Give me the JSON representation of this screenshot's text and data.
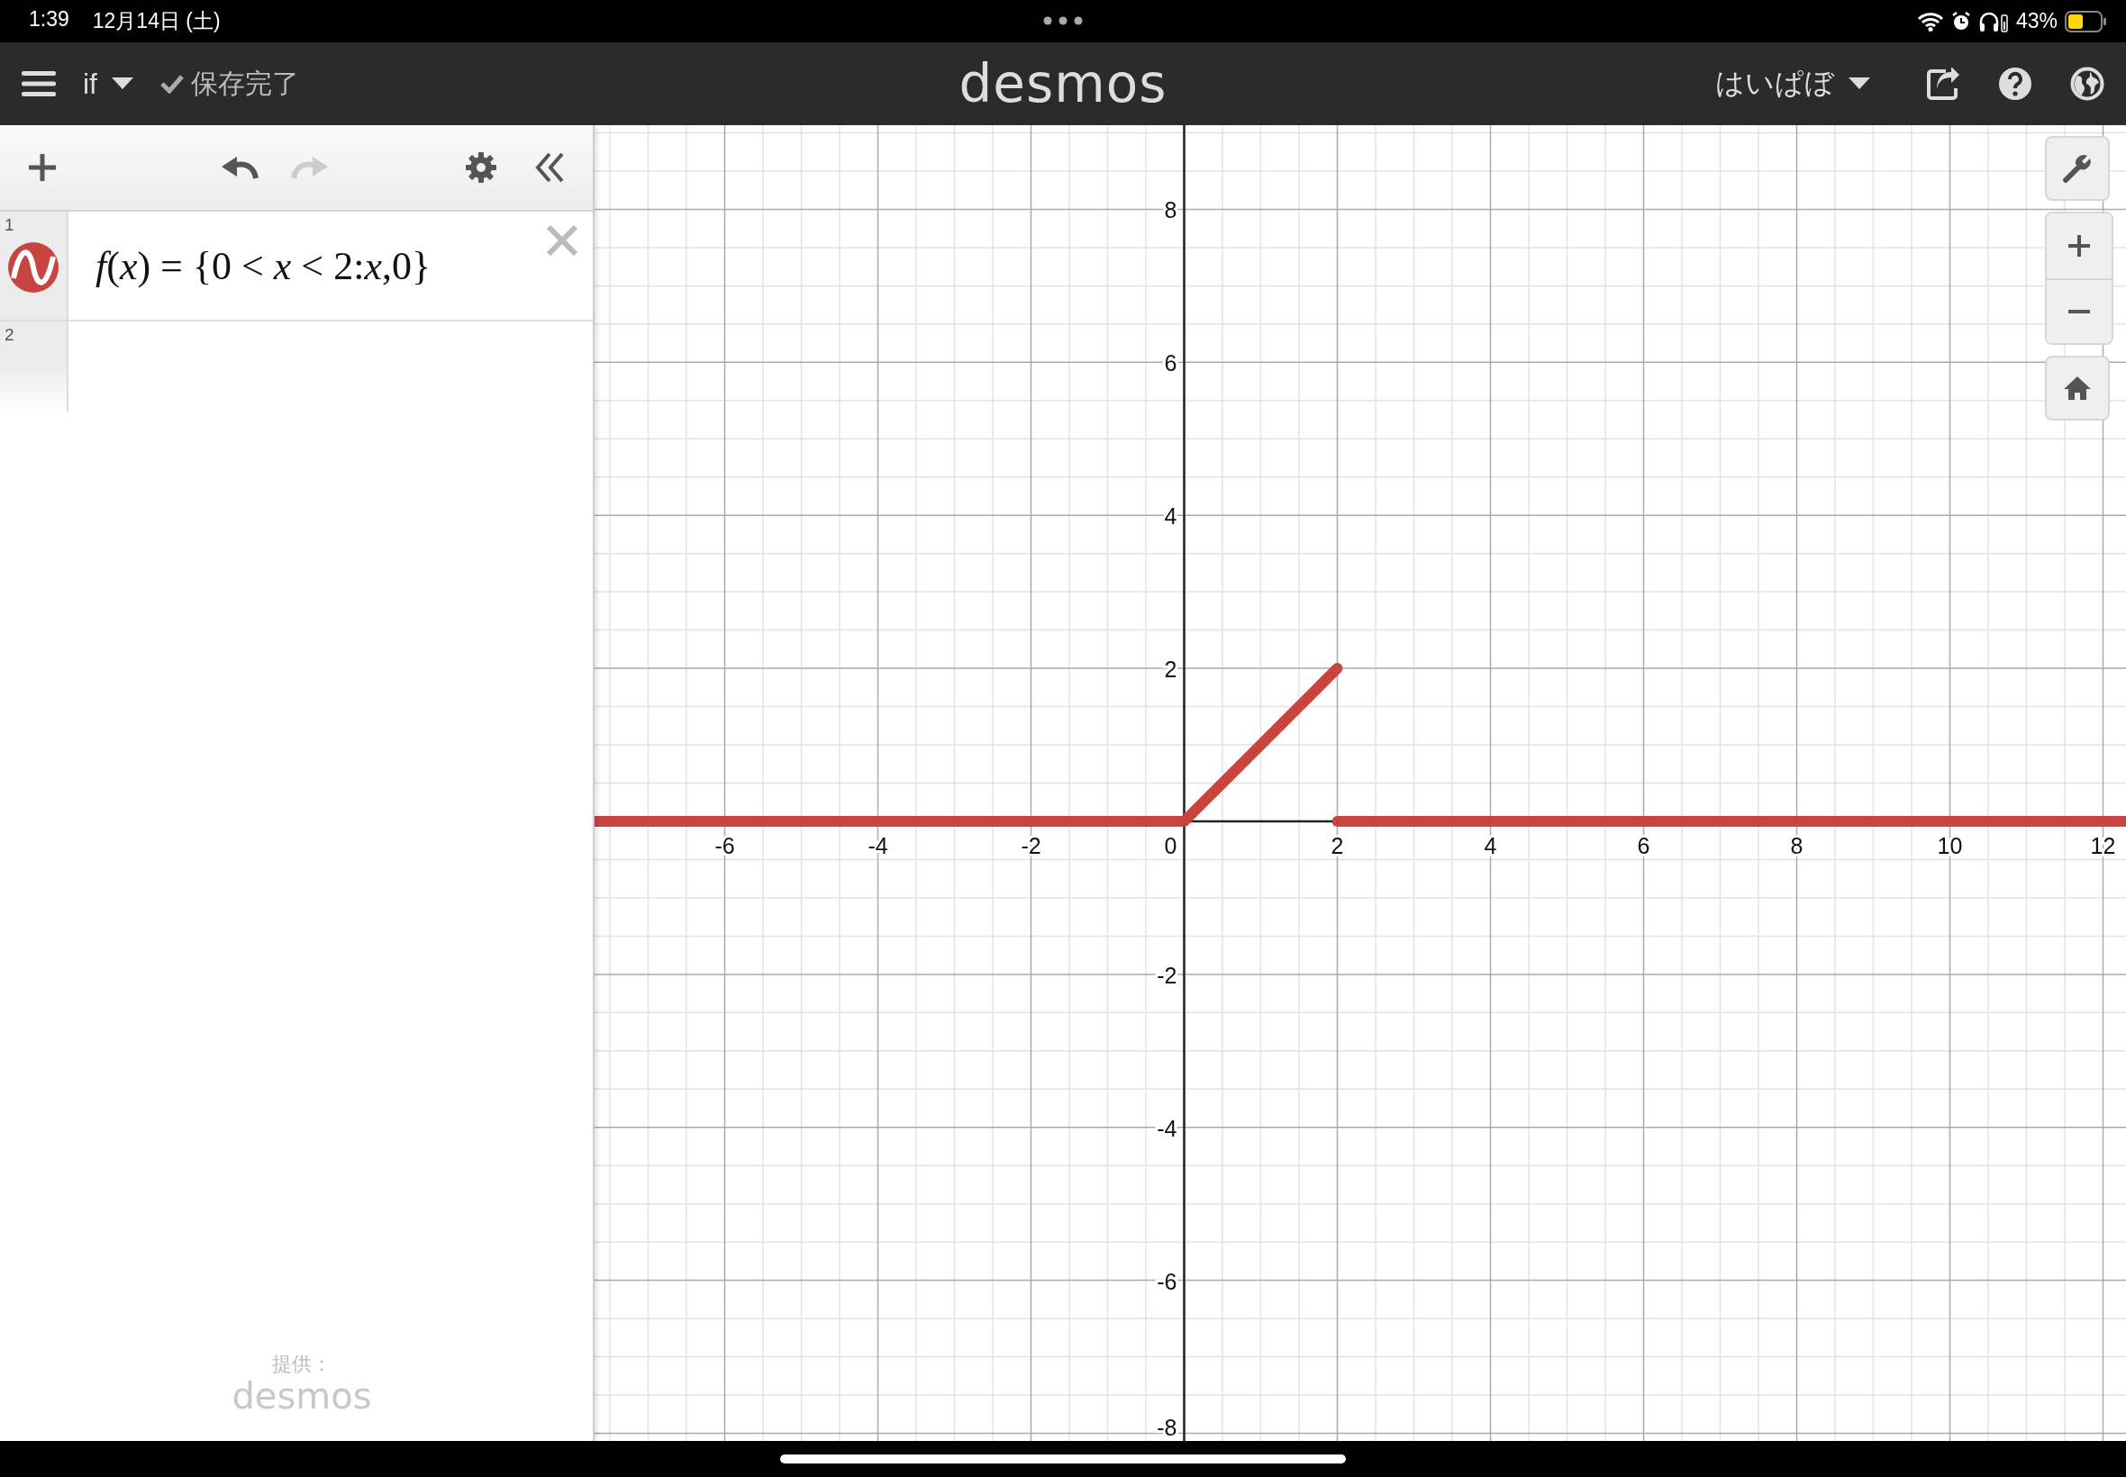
{
  "status_bar": {
    "time": "1:39",
    "date": "12月14日 (土)",
    "battery": "43%"
  },
  "top_bar": {
    "graph_title": "if",
    "save_status": "保存完了",
    "logo": "desmos",
    "user": "はいぱぼ"
  },
  "expressions": [
    {
      "number": "1",
      "formula": "*f*(*x*) = {0 < *x* < 2:*x*,0}",
      "color": "#c74440"
    },
    {
      "number": "2"
    }
  ],
  "footer": {
    "label": "提供：",
    "logo": "desmos"
  },
  "graph": {
    "origin_label": "0",
    "chart_data": {
      "type": "line",
      "grid": true,
      "xlim": [
        -7.7,
        12.3
      ],
      "ylim": [
        -8.1,
        9.1
      ],
      "xticks": [
        -6,
        -4,
        -2,
        2,
        4,
        6,
        8,
        10,
        12
      ],
      "yticks": [
        -8,
        -6,
        -4,
        -2,
        2,
        4,
        6,
        8
      ],
      "x": [
        -7.7,
        0,
        2,
        2,
        12.3
      ],
      "series": [
        {
          "color": "#c74440",
          "values": [
            0,
            0,
            2,
            null,
            null
          ]
        },
        {
          "color": "#c74440",
          "values": [
            null,
            null,
            null,
            0,
            0
          ]
        }
      ]
    }
  }
}
